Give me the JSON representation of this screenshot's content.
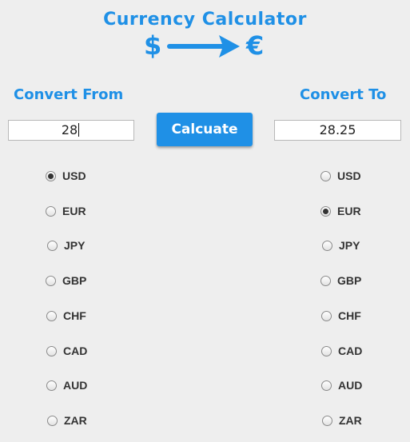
{
  "app": {
    "title": "Currency Calculator"
  },
  "logo": {
    "left_symbol": "$",
    "right_symbol": "€",
    "arrow_icon": "right-arrow-icon",
    "color": "#1f90e6"
  },
  "from": {
    "label": "Convert From",
    "value": "28",
    "selected": "USD",
    "options": [
      "USD",
      "EUR",
      "JPY",
      "GBP",
      "CHF",
      "CAD",
      "AUD",
      "ZAR"
    ]
  },
  "to": {
    "label": "Convert To",
    "value": "28.25",
    "selected": "EUR",
    "options": [
      "USD",
      "EUR",
      "JPY",
      "GBP",
      "CHF",
      "CAD",
      "AUD",
      "ZAR"
    ]
  },
  "button": {
    "label": "Calcuate"
  },
  "colors": {
    "accent": "#1f90e6",
    "background": "#eeeeee",
    "text": "#333333"
  }
}
